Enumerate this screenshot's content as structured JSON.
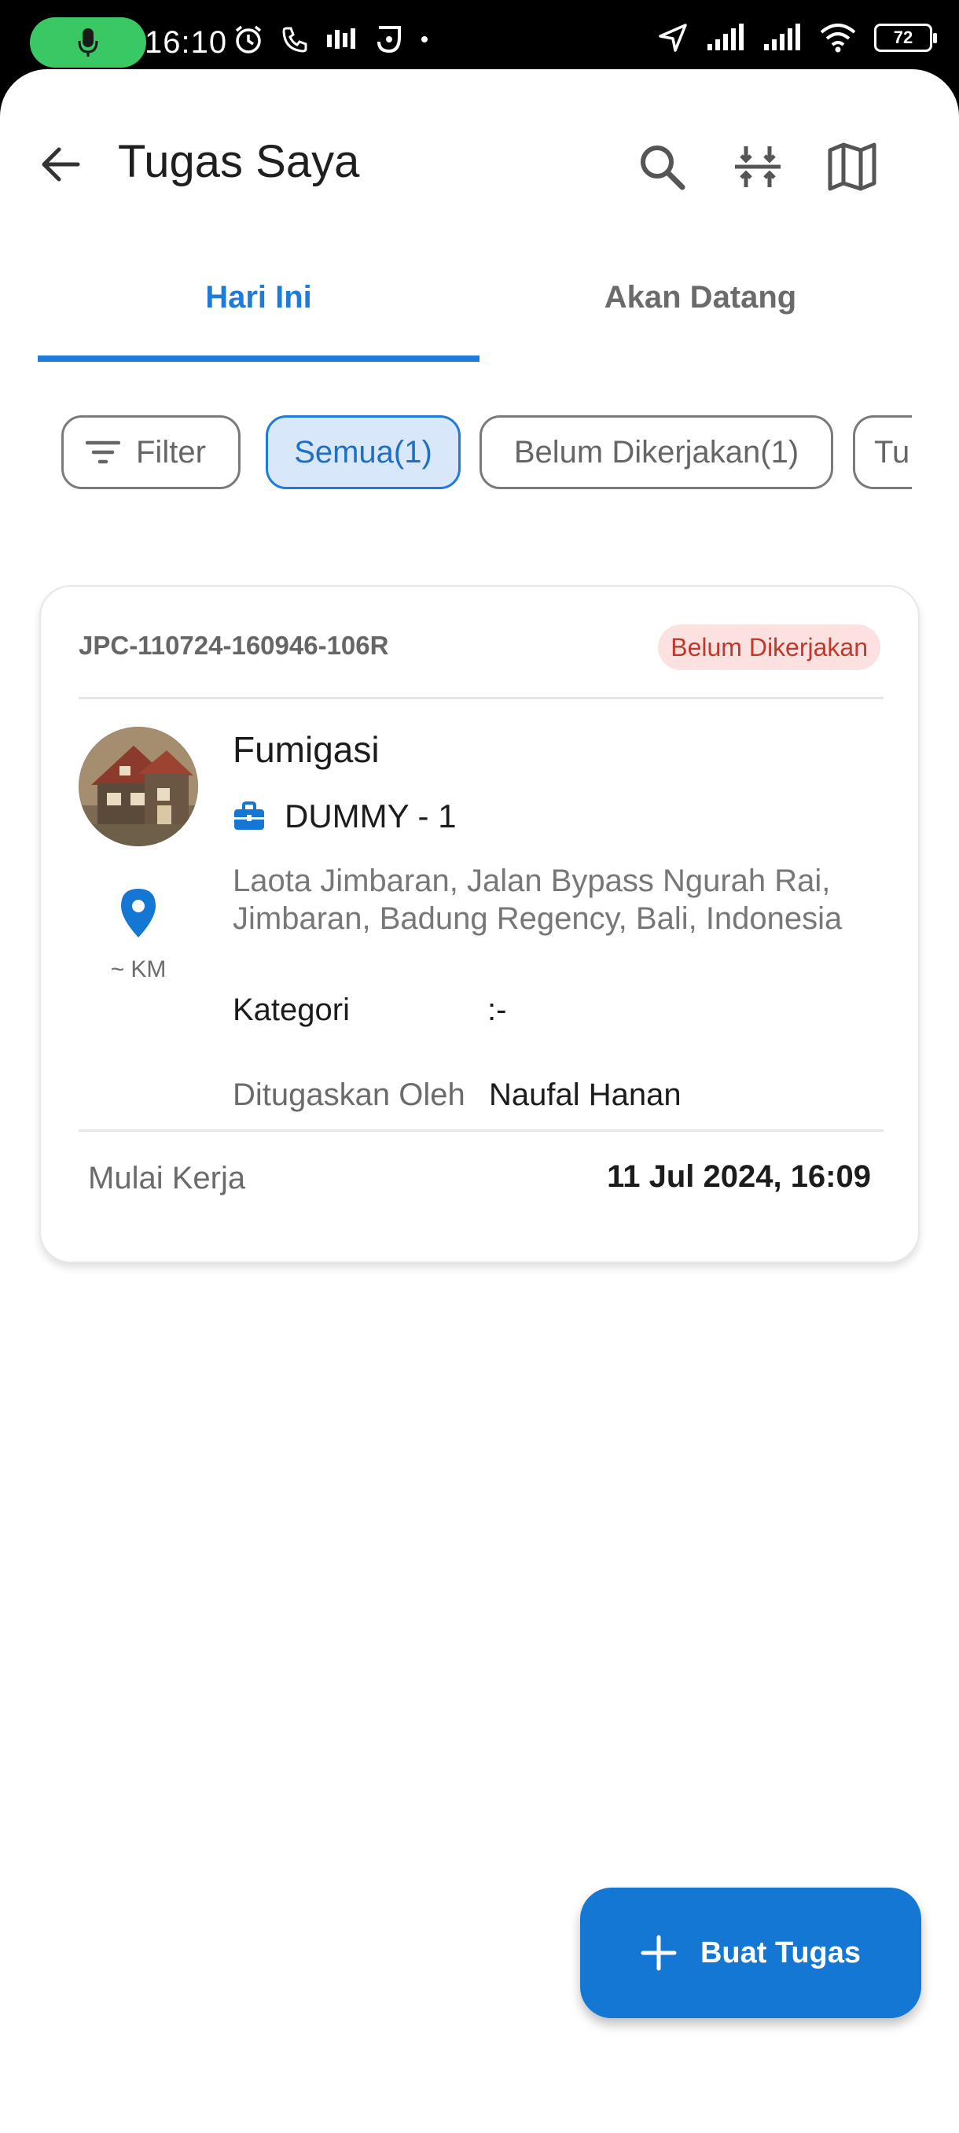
{
  "status_bar": {
    "time": "16:10",
    "battery": "72"
  },
  "header": {
    "title": "Tugas Saya"
  },
  "tabs": [
    {
      "label": "Hari Ini",
      "active": true
    },
    {
      "label": "Akan Datang",
      "active": false
    }
  ],
  "filters": {
    "filter_label": "Filter",
    "chips": [
      {
        "label": "Semua(1)",
        "selected": true
      },
      {
        "label": "Belum Dikerjakan(1)",
        "selected": false
      },
      {
        "label": "Tu",
        "selected": false
      }
    ]
  },
  "task_card": {
    "code": "JPC-110724-160946-106R",
    "status": "Belum Dikerjakan",
    "service": "Fumigasi",
    "client": "DUMMY - 1",
    "address": "Laota Jimbaran, Jalan Bypass Ngurah Rai, Jimbaran, Badung Regency, Bali, Indonesia",
    "distance": "~ KM",
    "category_label": "Kategori",
    "category_value": ":-",
    "assigned_by_label": "Ditugaskan Oleh",
    "assigned_by_value": "Naufal Hanan",
    "start_label": "Mulai Kerja",
    "start_value": "11 Jul 2024, 16:09"
  },
  "fab": {
    "label": "Buat Tugas"
  },
  "colors": {
    "primary": "#1f7bd9",
    "fab": "#1477d4",
    "status_bg": "#fde1e1",
    "status_text": "#c0392b"
  }
}
